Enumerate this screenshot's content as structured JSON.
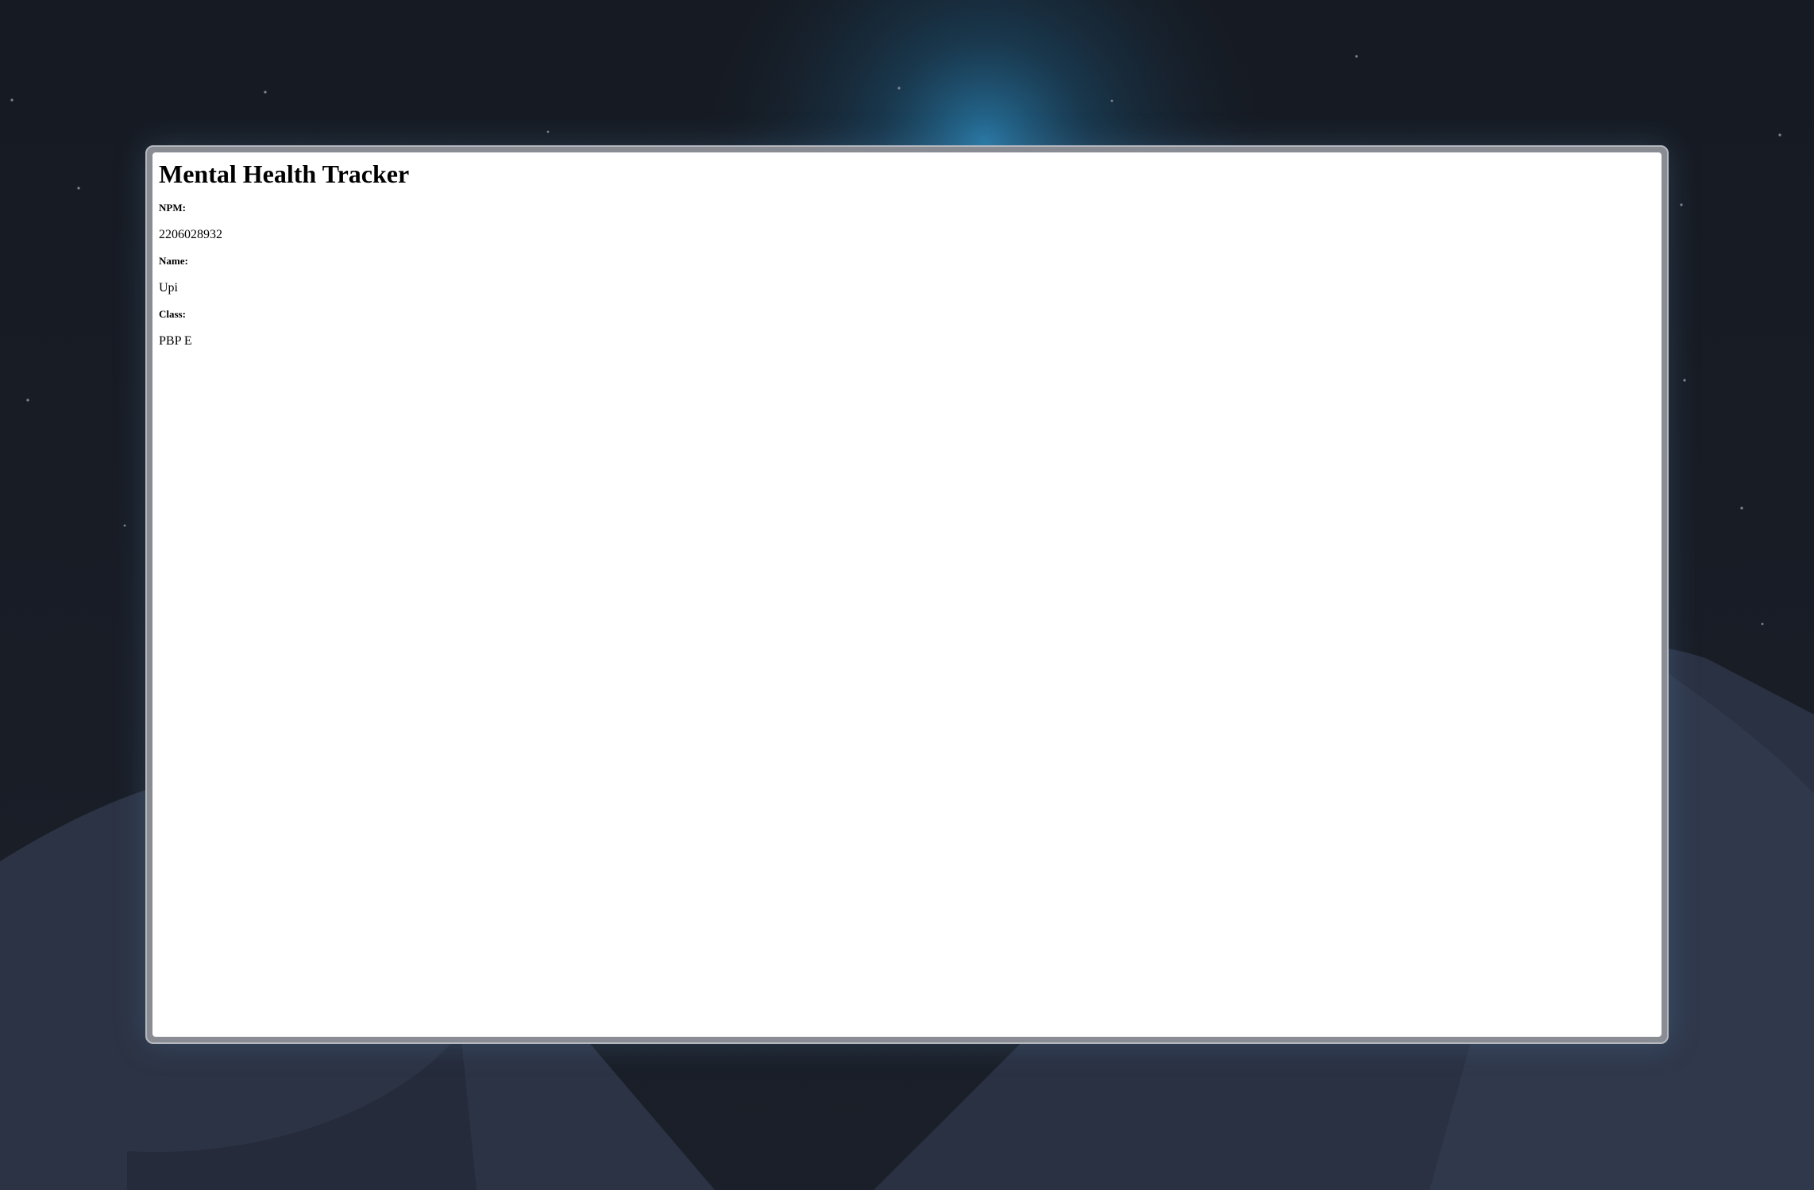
{
  "page": {
    "title": "Mental Health Tracker"
  },
  "profile": {
    "npm_label": "NPM:",
    "npm_value": "2206028932",
    "name_label": "Name:",
    "name_value": "Upi",
    "class_label": "Class:",
    "class_value": "PBP E"
  },
  "colors": {
    "background": "#151820",
    "glow": "#1f6f9e",
    "mountains": "#2e3547",
    "frame": "#8a8c93",
    "content": "#ffffff"
  }
}
